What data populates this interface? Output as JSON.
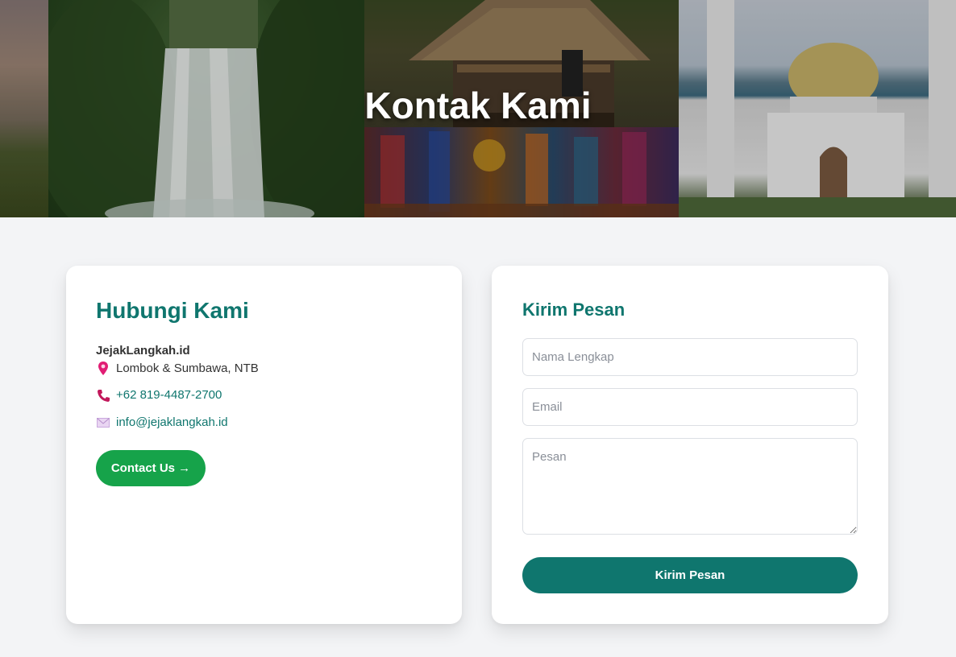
{
  "hero": {
    "title": "Kontak Kami",
    "images": [
      "sunset-icon",
      "waterfall-image",
      "traditional-house-image",
      "market-image",
      "mosque-image"
    ]
  },
  "contact": {
    "heading": "Hubungi Kami",
    "brand": "JejakLangkah.id",
    "location": "Lombok & Sumbawa, NTB",
    "phone": "+62 819-4487-2700",
    "email": "info@jejaklangkah.id",
    "button_label": "Contact Us →",
    "icons": {
      "location": "map-pin-icon",
      "phone": "phone-icon",
      "email": "envelope-icon"
    }
  },
  "form": {
    "heading": "Kirim Pesan",
    "name_placeholder": "Nama Lengkap",
    "email_placeholder": "Email",
    "message_placeholder": "Pesan",
    "submit_label": "Kirim Pesan"
  },
  "colors": {
    "primary_teal": "#0f766e",
    "button_green": "#16a34a",
    "background": "#f3f4f6",
    "pin_pink": "#e11d74"
  }
}
